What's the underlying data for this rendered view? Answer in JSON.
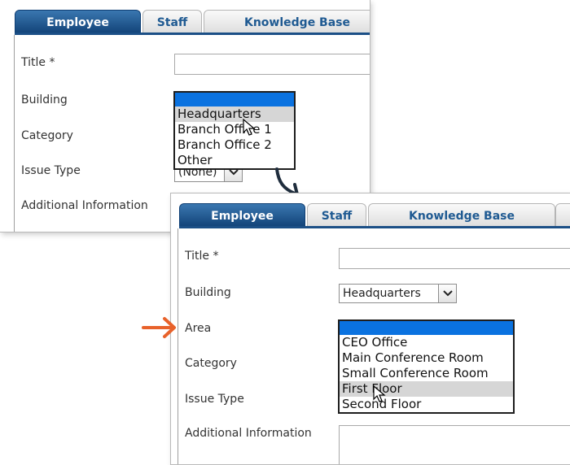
{
  "tabs": [
    "Employee",
    "Staff",
    "Knowledge Base"
  ],
  "panel_a": {
    "labels": {
      "title": "Title *",
      "building": "Building",
      "category": "Category",
      "issue_type": "Issue Type",
      "additional_info": "Additional Information"
    },
    "issue_type_value": "(None)",
    "building_options": [
      "",
      "Headquarters",
      "Branch Office 1",
      "Branch Office 2",
      "Other"
    ],
    "hovered_option": "Headquarters"
  },
  "panel_b": {
    "labels": {
      "title": "Title *",
      "building": "Building",
      "area": "Area",
      "category": "Category",
      "issue_type": "Issue Type",
      "additional_info": "Additional Information"
    },
    "building_value": "Headquarters",
    "area_options": [
      "",
      "CEO Office",
      "Main Conference Room",
      "Small Conference Room",
      "First Floor",
      "Second Floor"
    ],
    "hovered_option": "First Floor"
  },
  "colors": {
    "active_tab": "#1b4f86",
    "highlight_blue": "#0a72e0",
    "hover_gray": "#d6d6d6",
    "callout_arrow": "#e8622b",
    "connector_arrow": "#1f2d3d"
  }
}
